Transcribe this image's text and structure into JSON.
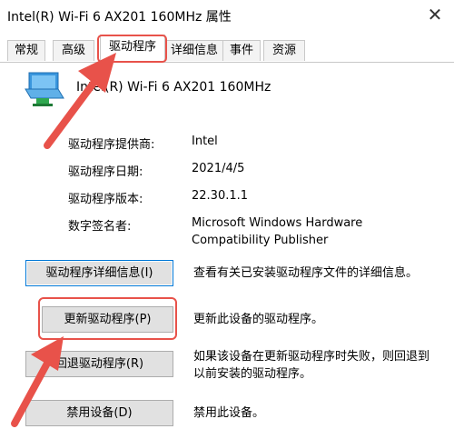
{
  "window": {
    "title": "Intel(R) Wi-Fi 6 AX201 160MHz 属性",
    "close_glyph": "✕"
  },
  "tabs": [
    {
      "label": "常规"
    },
    {
      "label": "高级"
    },
    {
      "label": "驱动程序",
      "active": true
    },
    {
      "label": "详细信息"
    },
    {
      "label": "事件"
    },
    {
      "label": "资源"
    }
  ],
  "device": {
    "name": "Intel(R) Wi-Fi 6 AX201 160MHz",
    "icon": "network-adapter-icon"
  },
  "info": [
    {
      "label": "驱动程序提供商:",
      "value": "Intel"
    },
    {
      "label": "驱动程序日期:",
      "value": "2021/4/5"
    },
    {
      "label": "驱动程序版本:",
      "value": "22.30.1.1"
    },
    {
      "label": "数字签名者:",
      "value": "Microsoft Windows Hardware Compatibility Publisher"
    }
  ],
  "actions": [
    {
      "label": "驱动程序详细信息(I)",
      "desc": "查看有关已安装驱动程序文件的详细信息。"
    },
    {
      "label": "更新驱动程序(P)",
      "desc": "更新此设备的驱动程序。"
    },
    {
      "label": "回退驱动程序(R)",
      "desc": "如果该设备在更新驱动程序时失败，则回退到以前安装的驱动程序。"
    },
    {
      "label": "禁用设备(D)",
      "desc": "禁用此设备。"
    }
  ],
  "annotation": {
    "color": "#e8524a"
  }
}
